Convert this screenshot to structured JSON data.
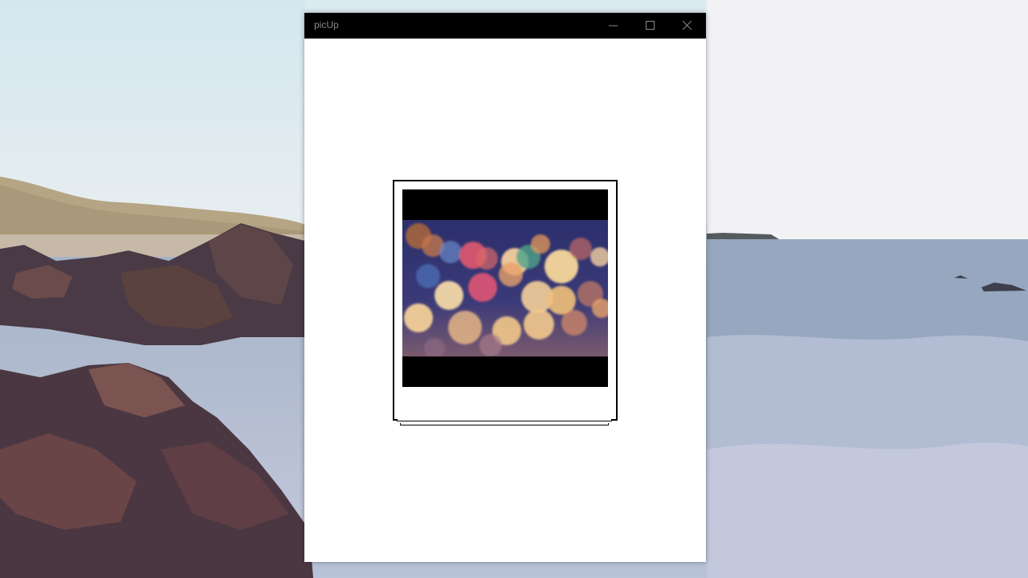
{
  "window": {
    "title": "picUp",
    "controls": {
      "minimize": "minimize-icon",
      "maximize": "maximize-icon",
      "close": "close-icon"
    }
  },
  "photo": {
    "description_icon": "bokeh-lights-image"
  },
  "colors": {
    "titlebar": "#000000",
    "window_bg": "#ffffff",
    "frame_border": "#000000"
  }
}
